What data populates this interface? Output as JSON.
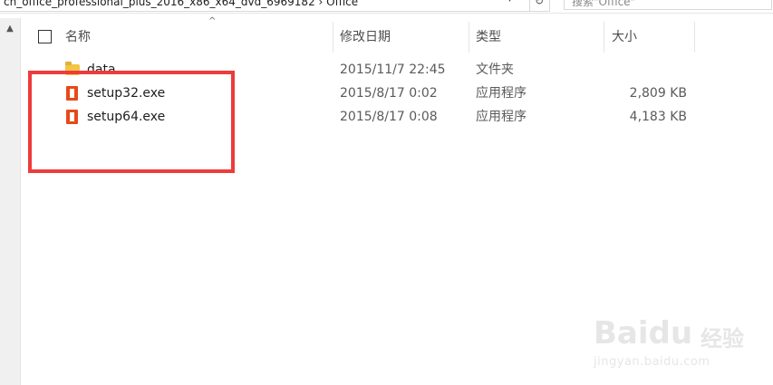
{
  "topbar": {
    "address": "cn_office_professional_plus_2016_x86_x64_dvd_6969182 › Office",
    "dropdown_icon": "chevron-down-icon",
    "refresh_icon": "refresh-icon",
    "search_placeholder": "搜索\"Office\""
  },
  "columns": {
    "name": "名称",
    "date": "修改日期",
    "type": "类型",
    "size": "大小"
  },
  "sort_indicator": "^",
  "files": [
    {
      "name": "data",
      "date": "2015/11/7 22:45",
      "type": "文件夹",
      "size": "",
      "icon": "folder-icon"
    },
    {
      "name": "setup32.exe",
      "date": "2015/8/17 0:02",
      "type": "应用程序",
      "size": "2,809 KB",
      "icon": "office-icon"
    },
    {
      "name": "setup64.exe",
      "date": "2015/8/17 0:08",
      "type": "应用程序",
      "size": "4,183 KB",
      "icon": "office-icon"
    }
  ],
  "watermark": {
    "logo": "Bai",
    "logo_suffix": "du",
    "cn": "经验",
    "url": "jingyan.baidu.com"
  },
  "highlight_color": "#ee3b3b"
}
